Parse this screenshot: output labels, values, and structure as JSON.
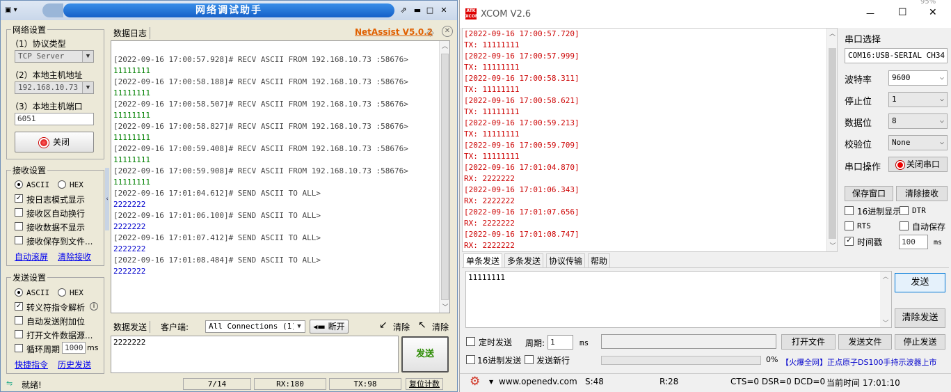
{
  "netassist": {
    "title": "网络调试助手",
    "brand": "NetAssist V5.0.2",
    "network_settings": {
      "legend": "网络设置",
      "protocol_label": "（1）协议类型",
      "protocol_value": "TCP Server",
      "host_label": "（2）本地主机地址",
      "host_value": "192.168.10.73",
      "port_label": "（3）本地主机端口",
      "port_value": "6051",
      "close_button": "关闭"
    },
    "receive_settings": {
      "legend": "接收设置",
      "ascii": "ASCII",
      "hex": "HEX",
      "log_mode": "按日志模式显示",
      "auto_wrap": "接收区自动换行",
      "no_show": "接收数据不显示",
      "save_to_file": "接收保存到文件...",
      "auto_scroll": "自动滚屏",
      "clear_recv": "清除接收"
    },
    "send_settings": {
      "legend": "发送设置",
      "ascii": "ASCII",
      "hex": "HEX",
      "escape": "转义符指令解析",
      "auto_append": "自动发送附加位",
      "open_file": "打开文件数据源...",
      "loop_period": "循环周期",
      "loop_value": "1000",
      "loop_unit": "ms",
      "shortcut": "快捷指令",
      "history": "历史发送"
    },
    "log_tab": "数据日志",
    "log": [
      {
        "head": "[2022-09-16 17:00:57.928]# RECV ASCII FROM 192.168.10.73 :58676>",
        "body": "11111111"
      },
      {
        "head": "[2022-09-16 17:00:58.188]# RECV ASCII FROM 192.168.10.73 :58676>",
        "body": "11111111"
      },
      {
        "head": "[2022-09-16 17:00:58.507]# RECV ASCII FROM 192.168.10.73 :58676>",
        "body": "11111111"
      },
      {
        "head": "[2022-09-16 17:00:58.827]# RECV ASCII FROM 192.168.10.73 :58676>",
        "body": "11111111"
      },
      {
        "head": "[2022-09-16 17:00:59.408]# RECV ASCII FROM 192.168.10.73 :58676>",
        "body": "11111111"
      },
      {
        "head": "[2022-09-16 17:00:59.908]# RECV ASCII FROM 192.168.10.73 :58676>",
        "body": "11111111"
      },
      {
        "head": "[2022-09-16 17:01:04.612]# SEND ASCII TO ALL>",
        "body": "2222222"
      },
      {
        "head": "[2022-09-16 17:01:06.100]# SEND ASCII TO ALL>",
        "body": "2222222"
      },
      {
        "head": "[2022-09-16 17:01:07.412]# SEND ASCII TO ALL>",
        "body": "2222222"
      },
      {
        "head": "[2022-09-16 17:01:08.484]# SEND ASCII TO ALL>",
        "body": "2222222"
      }
    ],
    "send_tab": "数据发送",
    "client_label": "客户端:",
    "client_value": "All Connections (1)",
    "disconnect": "断开",
    "clear1": "清除",
    "clear2": "清除",
    "send_text": "2222222",
    "send_button": "发送",
    "status": {
      "ready": "就绪!",
      "count": "7/14",
      "rx": "RX:180",
      "tx": "TX:98",
      "reset": "复位计数"
    },
    "colors": {
      "recv": "#008000",
      "send": "#0000cc",
      "brand": "#e06000",
      "title_bar": "#1a66cc"
    }
  },
  "xcom": {
    "title": "XCOM V2.6",
    "log": [
      {
        "head": "[2022-09-16 17:00:57.720]",
        "body": "TX: 11111111"
      },
      {
        "head": "[2022-09-16 17:00:57.999]",
        "body": "TX: 11111111"
      },
      {
        "head": "[2022-09-16 17:00:58.311]",
        "body": "TX: 11111111"
      },
      {
        "head": "[2022-09-16 17:00:58.621]",
        "body": "TX: 11111111"
      },
      {
        "head": "[2022-09-16 17:00:59.213]",
        "body": "TX: 11111111"
      },
      {
        "head": "[2022-09-16 17:00:59.709]",
        "body": "TX: 11111111"
      },
      {
        "head": "[2022-09-16 17:01:04.870]",
        "body": "RX: 2222222"
      },
      {
        "head": "[2022-09-16 17:01:06.343]",
        "body": "RX: 2222222"
      },
      {
        "head": "[2022-09-16 17:01:07.656]",
        "body": "RX: 2222222"
      },
      {
        "head": "[2022-09-16 17:01:08.747]",
        "body": "RX: 2222222"
      }
    ],
    "port_select_label": "串口选择",
    "port_value": "COM16:USB-SERIAL CH34",
    "baud_label": "波特率",
    "baud_value": "9600",
    "stop_label": "停止位",
    "stop_value": "1",
    "data_label": "数据位",
    "data_value": "8",
    "parity_label": "校验位",
    "parity_value": "None",
    "port_op_label": "串口操作",
    "close_port": "关闭串口",
    "save_window": "保存窗口",
    "clear_recv": "清除接收",
    "hex_display": "16进制显示",
    "dtr": "DTR",
    "rts": "RTS",
    "auto_save": "自动保存",
    "timestamp": "时间戳",
    "timestamp_value": "100",
    "timestamp_unit": "ms",
    "tabs": [
      "单条发送",
      "多条发送",
      "协议传输",
      "帮助"
    ],
    "send_text": "11111111",
    "send_button": "发送",
    "clear_send": "清除发送",
    "timed_send": "定时发送",
    "period_label": "周期:",
    "period_value": "1",
    "period_unit": "ms",
    "open_file": "打开文件",
    "send_file": "发送文件",
    "stop_send": "停止发送",
    "hex_send": "16进制发送",
    "send_newline": "发送新行",
    "progress": "0%",
    "ad": "【火爆全网】正点原子DS100手持示波器上市",
    "status": {
      "url": "www.openedv.com",
      "s": "S:48",
      "r": "R:28",
      "lines": "CTS=0 DSR=0 DCD=0",
      "time": "当前时间 17:01:10"
    },
    "zoom": "95%",
    "colors": {
      "log_head": "#cc0000",
      "ad": "#0000cc"
    }
  }
}
